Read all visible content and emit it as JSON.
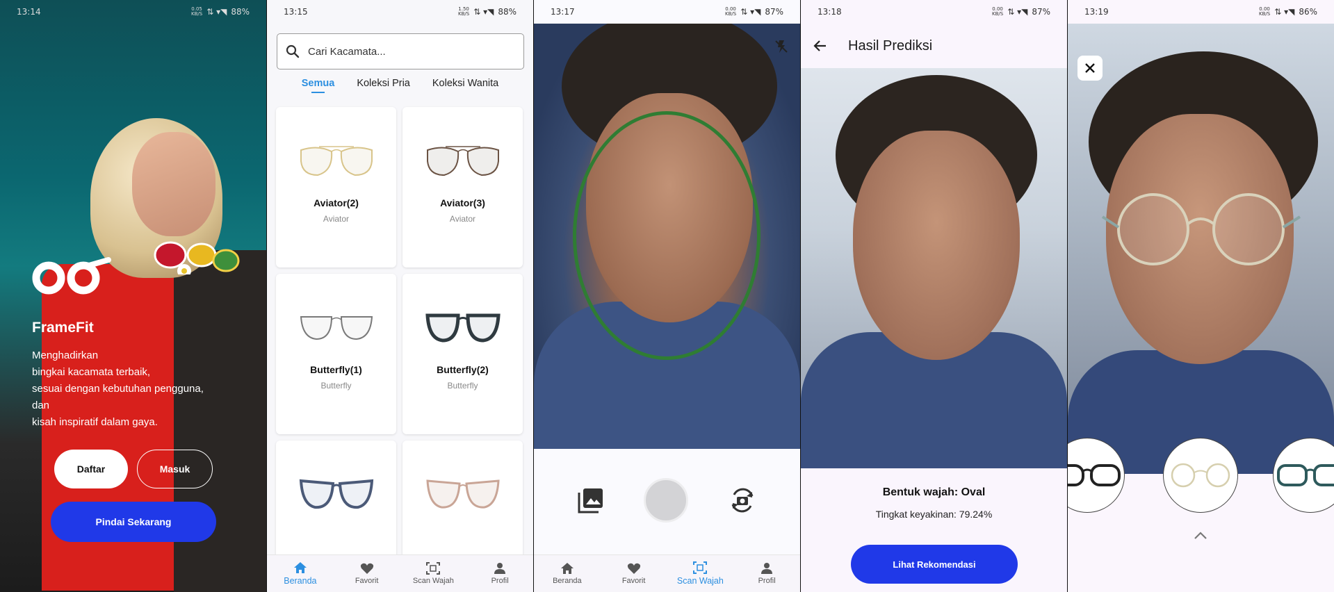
{
  "screens": {
    "welcome": {
      "status": {
        "time": "13:14",
        "net_top": "0.05",
        "net_bottom": "KB/S",
        "battery": "88%"
      },
      "brand": "FrameFit",
      "tagline_lines": [
        "Menghadirkan",
        "bingkai kacamata terbaik,",
        "sesuai dengan kebutuhan pengguna,",
        "dan",
        "kisah inspiratif dalam gaya."
      ],
      "daftar_label": "Daftar",
      "masuk_label": "Masuk",
      "pindai_label": "Pindai Sekarang"
    },
    "catalog": {
      "status": {
        "time": "13:15",
        "net_top": "1.50",
        "net_bottom": "KB/S",
        "battery": "88%"
      },
      "search_placeholder": "Cari Kacamata...",
      "tabs": [
        "Semua",
        "Koleksi Pria",
        "Koleksi Wanita"
      ],
      "products": [
        {
          "name": "Aviator(2)",
          "category": "Aviator"
        },
        {
          "name": "Aviator(3)",
          "category": "Aviator"
        },
        {
          "name": "Butterfly(1)",
          "category": "Butterfly"
        },
        {
          "name": "Butterfly(2)",
          "category": "Butterfly"
        }
      ]
    },
    "scan": {
      "status": {
        "time": "13:17",
        "net_top": "0.00",
        "net_bottom": "KB/S",
        "battery": "87%"
      }
    },
    "result": {
      "status": {
        "time": "13:18",
        "net_top": "0.00",
        "net_bottom": "KB/S",
        "battery": "87%"
      },
      "title": "Hasil Prediksi",
      "shape_text": "Bentuk wajah: Oval",
      "confidence_text": "Tingkat keyakinan: 79.24%",
      "button_label": "Lihat Rekomendasi"
    },
    "tryon": {
      "status": {
        "time": "13:19",
        "net_top": "0.00",
        "net_bottom": "KB/S",
        "battery": "86%"
      }
    }
  },
  "nav": [
    "Beranda",
    "Favorit",
    "Scan Wajah",
    "Profil"
  ],
  "colors": {
    "accent": "#2c8fe0",
    "primary_button": "#2039e8",
    "guide_oval": "#2f7d33"
  }
}
